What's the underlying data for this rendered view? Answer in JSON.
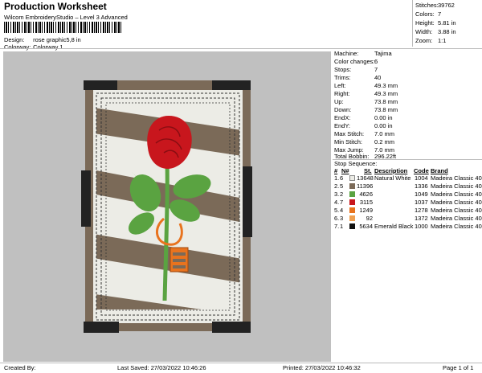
{
  "header": {
    "title": "Production Worksheet",
    "subtitle": "Wilcom EmbroideryStudio – Level 3 Advanced",
    "design_label": "Design:",
    "design_value": "rose graphic5,8 in",
    "colorway_label": "Colorway:",
    "colorway_value": "Colorway 1"
  },
  "summary": [
    {
      "k": "Stitches:",
      "v": "39762"
    },
    {
      "k": "Colors:",
      "v": "7"
    },
    {
      "k": "Height:",
      "v": "5.81 in"
    },
    {
      "k": "Width:",
      "v": "3.88 in"
    },
    {
      "k": "Zoom:",
      "v": "1:1"
    }
  ],
  "details": [
    {
      "k": "Machine:",
      "v": "Tajima"
    },
    {
      "k": "Color changes:",
      "v": "6"
    },
    {
      "k": "Stops:",
      "v": "7"
    },
    {
      "k": "Trims:",
      "v": "40"
    },
    {
      "k": "Left:",
      "v": "49.3 mm"
    },
    {
      "k": "Right:",
      "v": "49.3 mm"
    },
    {
      "k": "Up:",
      "v": "73.8 mm"
    },
    {
      "k": "Down:",
      "v": "73.8 mm"
    },
    {
      "k": "EndX:",
      "v": "0.00 in"
    },
    {
      "k": "EndY:",
      "v": "0.00 in"
    },
    {
      "k": "Max Stitch:",
      "v": "7.0 mm"
    },
    {
      "k": "Min Stitch:",
      "v": "0.2 mm"
    },
    {
      "k": "Max Jump:",
      "v": "7.0 mm"
    },
    {
      "k": "Total Bobbin:",
      "v": "296.22ft"
    }
  ],
  "stop_sequence": {
    "heading": "Stop Sequence:",
    "columns": [
      "#",
      "N#",
      "St.",
      "Description",
      "Code",
      "Brand"
    ],
    "rows": [
      {
        "n": "1.",
        "nn": "6",
        "color": "#ecece6",
        "st": "13648",
        "desc": "Natural White",
        "code": "1004",
        "brand": "Madeira Classic 40"
      },
      {
        "n": "2.",
        "nn": "5",
        "color": "#7b6a58",
        "st": "11396",
        "desc": "",
        "code": "1336",
        "brand": "Madeira Classic 40"
      },
      {
        "n": "3.",
        "nn": "2",
        "color": "#5aa341",
        "st": "4626",
        "desc": "",
        "code": "1049",
        "brand": "Madeira Classic 40"
      },
      {
        "n": "4.",
        "nn": "7",
        "color": "#c8161d",
        "st": "3115",
        "desc": "",
        "code": "1037",
        "brand": "Madeira Classic 40"
      },
      {
        "n": "5.",
        "nn": "4",
        "color": "#e8731e",
        "st": "1249",
        "desc": "",
        "code": "1278",
        "brand": "Madeira Classic 40"
      },
      {
        "n": "6.",
        "nn": "3",
        "color": "#f0a050",
        "st": "92",
        "desc": "",
        "code": "1372",
        "brand": "Madeira Classic 40"
      },
      {
        "n": "7.",
        "nn": "1",
        "color": "#111111",
        "st": "5634",
        "desc": "Emerald Black",
        "code": "1000",
        "brand": "Madeira Classic 40"
      }
    ]
  },
  "footer": {
    "created": "Created By:",
    "last_saved": "Last Saved: 27/03/2022 10:46:26",
    "printed": "Printed: 27/03/2022 10:46:32",
    "page": "Page 1 of 1"
  }
}
